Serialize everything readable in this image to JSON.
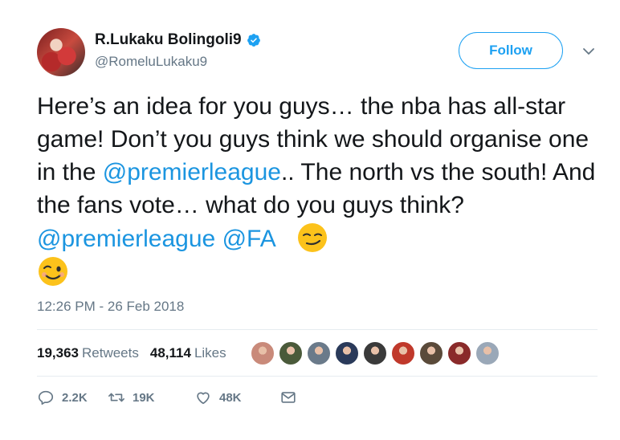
{
  "user": {
    "display_name": "R.Lukaku Bolingoli9",
    "handle": "@RomeluLukaku9",
    "verified": true
  },
  "follow_label": "Follow",
  "tweet": {
    "part1": "Here’s an idea for you guys… the nba has all-star game! Don’t you guys think we should organise one in the ",
    "mention1": "@premierleague",
    "part2": "..  The north vs the south! And the fans vote… what do you guys think? ",
    "mention2": "@premierleague",
    "space": " ",
    "mention3": "@FA",
    "emoji1": "smirking-face",
    "emoji2": "winking-face"
  },
  "timestamp": "12:26 PM - 26 Feb 2018",
  "stats": {
    "retweets_count": "19,363",
    "retweets_label": "Retweets",
    "likes_count": "48,114",
    "likes_label": "Likes"
  },
  "likers": [
    {
      "name": "liker-avatar-1",
      "color": "#c98a7a"
    },
    {
      "name": "liker-avatar-2",
      "color": "#4a5a3a"
    },
    {
      "name": "liker-avatar-3",
      "color": "#6a7a8a"
    },
    {
      "name": "liker-avatar-4",
      "color": "#2a3a5a"
    },
    {
      "name": "liker-avatar-5",
      "color": "#3a3a3a"
    },
    {
      "name": "liker-avatar-6",
      "color": "#c0392b"
    },
    {
      "name": "liker-avatar-7",
      "color": "#5a4a3a"
    },
    {
      "name": "liker-avatar-8",
      "color": "#8a2a2a"
    },
    {
      "name": "liker-avatar-9",
      "color": "#9aa8b8"
    }
  ],
  "actions": {
    "replies": "2.2K",
    "retweets": "19K",
    "likes": "48K"
  },
  "colors": {
    "accent": "#1da1f2",
    "link": "#1b95e0",
    "muted": "#657786"
  }
}
